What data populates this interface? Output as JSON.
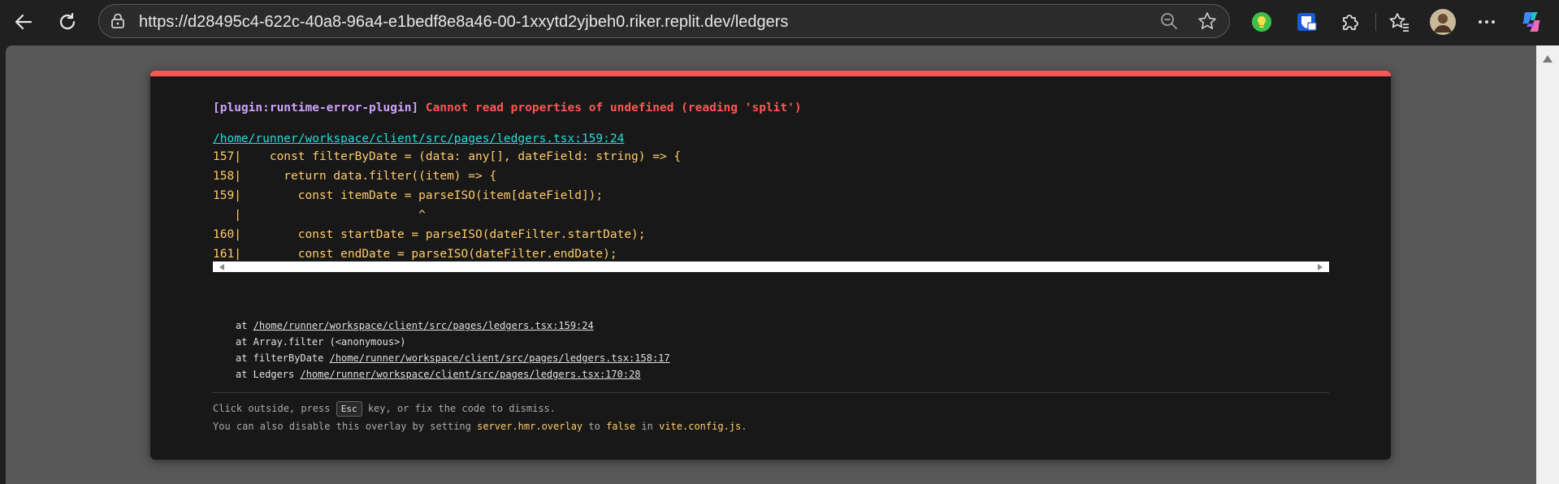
{
  "browser": {
    "url": "https://d28495c4-622c-40a8-96a4-e1bedf8e8a46-00-1xxytd2yjbeh0.riker.replit.dev/ledgers",
    "icons": [
      "back-icon",
      "refresh-icon",
      "lock-icon",
      "zoom-out-icon",
      "favorite-star-icon",
      "lightbulb-extension-icon",
      "bitwarden-extension-icon",
      "extensions-puzzle-icon",
      "favorites-icon",
      "profile-avatar",
      "more-menu-icon",
      "copilot-icon"
    ]
  },
  "overlay": {
    "plugin": "[plugin:runtime-error-plugin]",
    "message": "Cannot read properties of undefined (reading 'split')",
    "file": "/home/runner/workspace/client/src/pages/ledgers.tsx:159:24",
    "frame_lines": [
      "157|    const filterByDate = (data: any[], dateField: string) => {",
      "158|      return data.filter((item) => {",
      "159|        const itemDate = parseISO(item[dateField]);",
      "   |                         ^",
      "160|        const startDate = parseISO(dateFilter.startDate);",
      "161|        const endDate = parseISO(dateFilter.endDate);"
    ],
    "stack": [
      {
        "prefix": "at ",
        "link": "/home/runner/workspace/client/src/pages/ledgers.tsx:159:24"
      },
      {
        "prefix": "at Array.filter (<anonymous>)",
        "link": ""
      },
      {
        "prefix": "at filterByDate ",
        "link": "/home/runner/workspace/client/src/pages/ledgers.tsx:158:17"
      },
      {
        "prefix": "at Ledgers ",
        "link": "/home/runner/workspace/client/src/pages/ledgers.tsx:170:28"
      }
    ],
    "tip1": {
      "a": "Click outside, press ",
      "key": "Esc",
      "b": " key, or fix the code to dismiss."
    },
    "tip2": {
      "a": "You can also disable this overlay by setting ",
      "code1": "server.hmr.overlay",
      "b": " to ",
      "code2": "false",
      "c": " in ",
      "code3": "vite.config.js",
      "d": "."
    }
  },
  "colors": {
    "accent_error": "#ff5555",
    "plugin": "#cfa4ff",
    "file_link": "#2dd9da",
    "code": "#ffcb6b"
  }
}
